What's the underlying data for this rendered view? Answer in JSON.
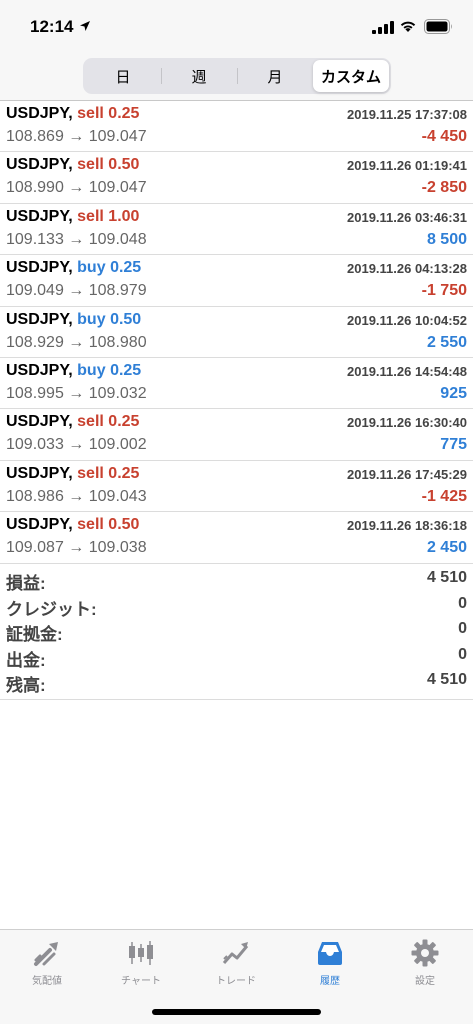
{
  "status": {
    "time": "12:14"
  },
  "segments": [
    "日",
    "週",
    "月",
    "カスタム"
  ],
  "active_segment": "カスタム",
  "trades": [
    {
      "symbol": "USDJPY,",
      "side": "sell",
      "lots": "0.25",
      "datetime": "2019.11.25 17:37:08",
      "open": "108.869",
      "close": "109.047",
      "profit": "-4 450"
    },
    {
      "symbol": "USDJPY,",
      "side": "sell",
      "lots": "0.50",
      "datetime": "2019.11.26 01:19:41",
      "open": "108.990",
      "close": "109.047",
      "profit": "-2 850"
    },
    {
      "symbol": "USDJPY,",
      "side": "sell",
      "lots": "1.00",
      "datetime": "2019.11.26 03:46:31",
      "open": "109.133",
      "close": "109.048",
      "profit": "8 500"
    },
    {
      "symbol": "USDJPY,",
      "side": "buy",
      "lots": "0.25",
      "datetime": "2019.11.26 04:13:28",
      "open": "109.049",
      "close": "108.979",
      "profit": "-1 750"
    },
    {
      "symbol": "USDJPY,",
      "side": "buy",
      "lots": "0.50",
      "datetime": "2019.11.26 10:04:52",
      "open": "108.929",
      "close": "108.980",
      "profit": "2 550"
    },
    {
      "symbol": "USDJPY,",
      "side": "buy",
      "lots": "0.25",
      "datetime": "2019.11.26 14:54:48",
      "open": "108.995",
      "close": "109.032",
      "profit": "925"
    },
    {
      "symbol": "USDJPY,",
      "side": "sell",
      "lots": "0.25",
      "datetime": "2019.11.26 16:30:40",
      "open": "109.033",
      "close": "109.002",
      "profit": "775"
    },
    {
      "symbol": "USDJPY,",
      "side": "sell",
      "lots": "0.25",
      "datetime": "2019.11.26 17:45:29",
      "open": "108.986",
      "close": "109.043",
      "profit": "-1 425"
    },
    {
      "symbol": "USDJPY,",
      "side": "sell",
      "lots": "0.50",
      "datetime": "2019.11.26 18:36:18",
      "open": "109.087",
      "close": "109.038",
      "profit": "2 450"
    }
  ],
  "summary": [
    {
      "label": "損益:",
      "value": "4 510"
    },
    {
      "label": "クレジット:",
      "value": "0"
    },
    {
      "label": "証拠金:",
      "value": "0"
    },
    {
      "label": "出金:",
      "value": "0"
    },
    {
      "label": "残高:",
      "value": "4 510"
    }
  ],
  "tabs": [
    {
      "label": "気配値",
      "icon": "quotes-icon"
    },
    {
      "label": "チャート",
      "icon": "chart-icon"
    },
    {
      "label": "トレード",
      "icon": "trade-icon"
    },
    {
      "label": "履歴",
      "icon": "history-icon"
    },
    {
      "label": "設定",
      "icon": "gear-icon"
    }
  ],
  "active_tab": "履歴",
  "colors": {
    "sell": "#c8412f",
    "buy": "#2f7fd6",
    "negative": "#c8412f",
    "positive": "#2f7fd6",
    "tab_active": "#2f7fd6",
    "tab_inactive": "#8e8e93"
  }
}
